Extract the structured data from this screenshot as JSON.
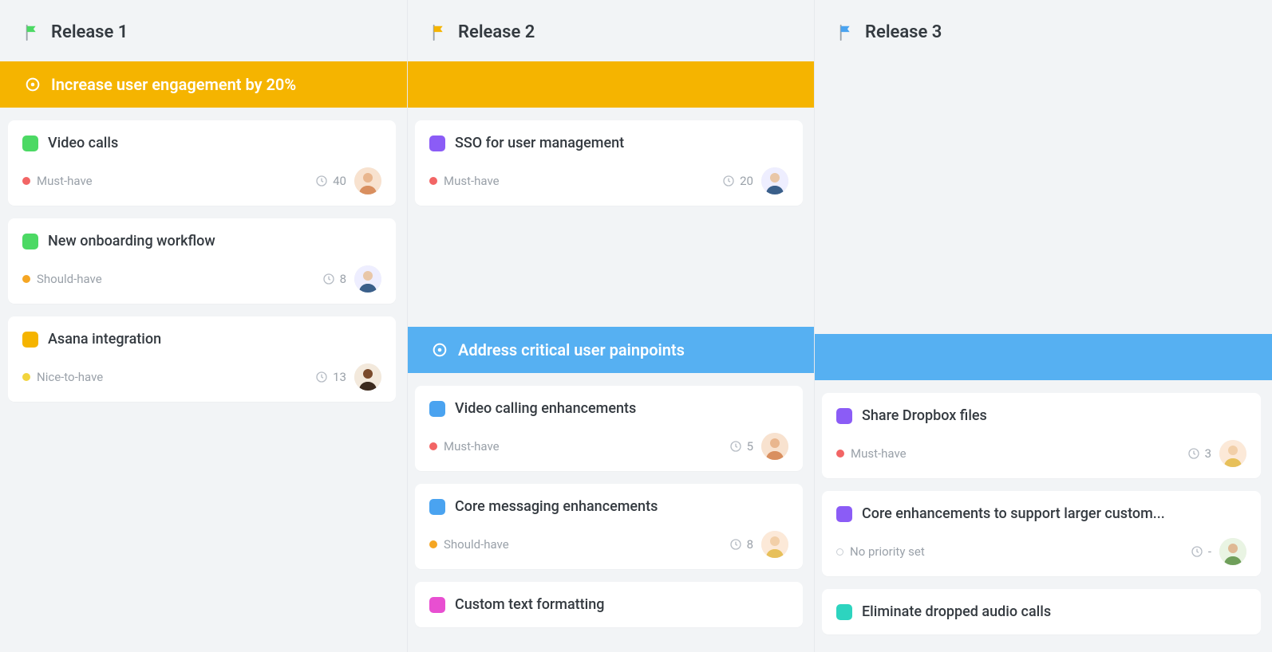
{
  "columns": [
    {
      "title": "Release 1",
      "flag_color": "#4cd964"
    },
    {
      "title": "Release 2",
      "flag_color": "#f5b400"
    },
    {
      "title": "Release 3",
      "flag_color": "#4aa3f0"
    }
  ],
  "goals": {
    "engagement": {
      "title": "Increase user engagement by 20%",
      "color": "#f5b400"
    },
    "painpoints": {
      "title": "Address critical user painpoints",
      "color": "#56b0f2"
    }
  },
  "priority_labels": {
    "must": "Must-have",
    "should": "Should-have",
    "nice": "Nice-to-have",
    "none": "No priority set"
  },
  "cards": {
    "col1_goal1": [
      {
        "title": "Video calls",
        "tag_color": "#4cd964",
        "priority": "must",
        "priority_color": "#f26565",
        "effort": "40",
        "avatar": "f1"
      },
      {
        "title": "New onboarding workflow",
        "tag_color": "#4cd964",
        "priority": "should",
        "priority_color": "#f5a623",
        "effort": "8",
        "avatar": "m1"
      },
      {
        "title": "Asana integration",
        "tag_color": "#f5b400",
        "priority": "nice",
        "priority_color": "#f2d43d",
        "effort": "13",
        "avatar": "f2"
      }
    ],
    "col2_goal1": [
      {
        "title": "SSO for user management",
        "tag_color": "#8b5cf6",
        "priority": "must",
        "priority_color": "#f26565",
        "effort": "20",
        "avatar": "m1"
      }
    ],
    "col2_goal2": [
      {
        "title": "Video calling enhancements",
        "tag_color": "#4aa3f0",
        "priority": "must",
        "priority_color": "#f26565",
        "effort": "5",
        "avatar": "f1"
      },
      {
        "title": "Core messaging enhancements",
        "tag_color": "#4aa3f0",
        "priority": "should",
        "priority_color": "#f5a623",
        "effort": "8",
        "avatar": "f3"
      },
      {
        "title": "Custom text formatting",
        "tag_color": "#e84fd1",
        "priority": "",
        "priority_color": "",
        "effort": "",
        "avatar": ""
      }
    ],
    "col3_goal2": [
      {
        "title": "Share Dropbox files",
        "tag_color": "#8b5cf6",
        "priority": "must",
        "priority_color": "#f26565",
        "effort": "3",
        "avatar": "f3"
      },
      {
        "title": "Core enhancements to support larger custom...",
        "tag_color": "#8b5cf6",
        "priority": "none",
        "priority_color": "empty",
        "effort": "-",
        "avatar": "f4"
      },
      {
        "title": "Eliminate dropped audio calls",
        "tag_color": "#2dd4bf",
        "priority": "",
        "priority_color": "",
        "effort": "",
        "avatar": ""
      }
    ]
  }
}
